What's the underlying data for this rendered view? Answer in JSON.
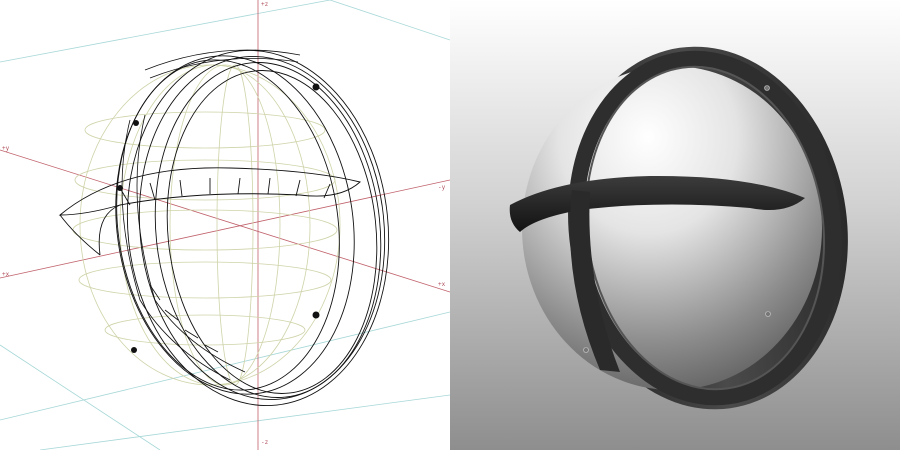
{
  "wireframe_view": {
    "axis_labels": {
      "z_top": "+z",
      "z_bottom": "-z",
      "y_left": "+y",
      "y_right": "-y",
      "x_left": "+x",
      "x_right": "+x"
    },
    "colors": {
      "axis": "#c0606a",
      "grid": "#a7d7d7",
      "sphere_wire": "#cfd3a8",
      "frame_wire": "#111111"
    }
  },
  "render_view": {
    "colors": {
      "background_top": "#ffffff",
      "background_bottom": "#8e8e8e",
      "frame": "#3a3a3a",
      "dome_highlight": "#ffffff",
      "dome_shadow": "#6a6a6a"
    }
  }
}
